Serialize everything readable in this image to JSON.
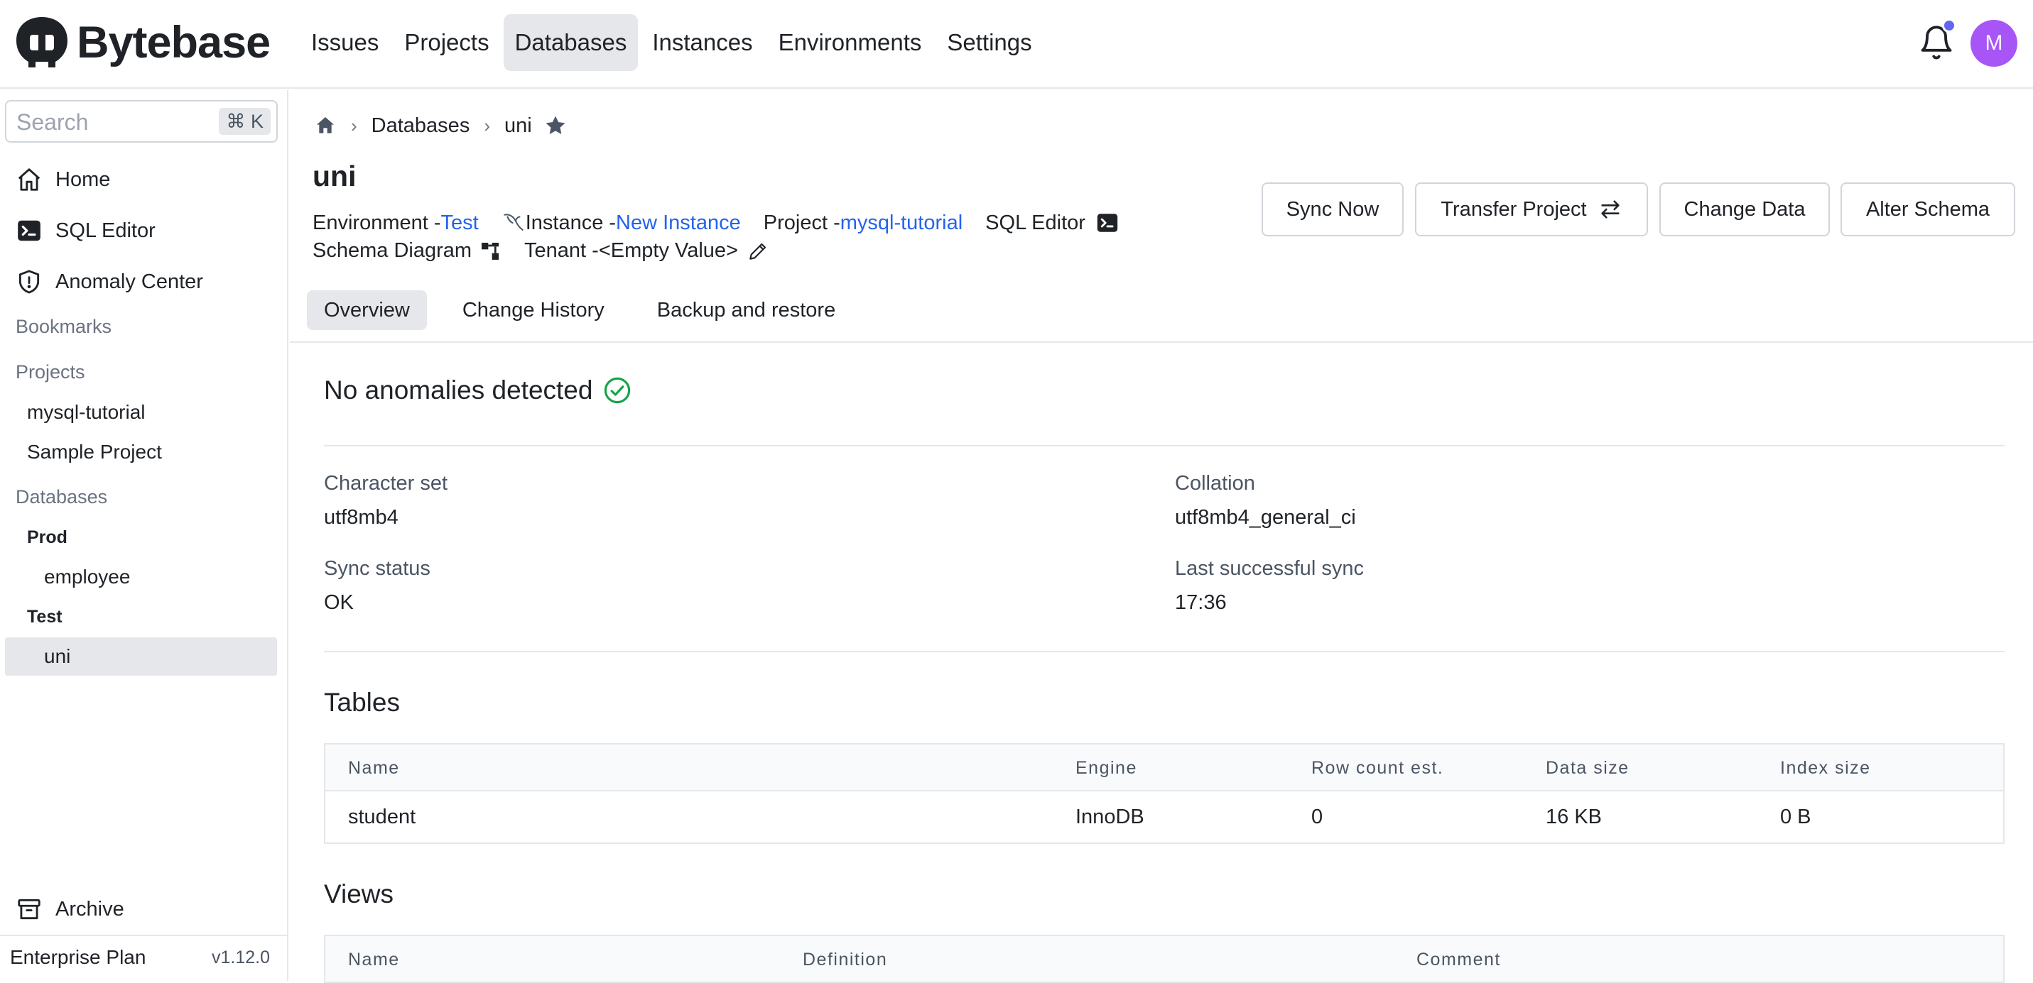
{
  "app": {
    "name": "Bytebase",
    "nav": [
      "Issues",
      "Projects",
      "Databases",
      "Instances",
      "Environments",
      "Settings"
    ],
    "active_nav": "Databases",
    "user_initial": "M",
    "accent_color": "#2563eb",
    "avatar_color": "#a855f7",
    "notification_dot_color": "#6366f1"
  },
  "sidebar": {
    "search_placeholder": "Search",
    "search_shortcut": "⌘ K",
    "links": [
      {
        "label": "Home",
        "icon": "home-icon"
      },
      {
        "label": "SQL Editor",
        "icon": "terminal-icon"
      },
      {
        "label": "Anomaly Center",
        "icon": "shield-icon"
      }
    ],
    "bookmarks_heading": "Bookmarks",
    "projects_heading": "Projects",
    "projects": [
      "mysql-tutorial",
      "Sample Project"
    ],
    "databases_heading": "Databases",
    "environments": [
      {
        "name": "Prod",
        "databases": [
          "employee"
        ]
      },
      {
        "name": "Test",
        "databases": [
          "uni"
        ]
      }
    ],
    "active_database": "uni",
    "archive_label": "Archive",
    "plan": "Enterprise Plan",
    "version": "v1.12.0"
  },
  "breadcrumb": {
    "section": "Databases",
    "current": "uni"
  },
  "database": {
    "name": "uni",
    "environment_label": "Environment - ",
    "environment": "Test",
    "instance_label": "Instance - ",
    "instance": "New Instance",
    "project_label": "Project - ",
    "project": "mysql-tutorial",
    "sql_editor_label": "SQL Editor",
    "schema_diagram_label": "Schema Diagram",
    "tenant_label": "Tenant - ",
    "tenant": "<Empty Value>"
  },
  "actions": {
    "sync_now": "Sync Now",
    "transfer_project": "Transfer Project",
    "change_data": "Change Data",
    "alter_schema": "Alter Schema"
  },
  "tabs": [
    "Overview",
    "Change History",
    "Backup and restore"
  ],
  "active_tab": "Overview",
  "overview": {
    "anomaly_status": "No anomalies detected",
    "properties": {
      "charset_label": "Character set",
      "charset": "utf8mb4",
      "collation_label": "Collation",
      "collation": "utf8mb4_general_ci",
      "sync_status_label": "Sync status",
      "sync_status": "OK",
      "last_sync_label": "Last successful sync",
      "last_sync": "17:36"
    },
    "tables_title": "Tables",
    "tables": {
      "columns": [
        "Name",
        "Engine",
        "Row count est.",
        "Data size",
        "Index size"
      ],
      "rows": [
        [
          "student",
          "InnoDB",
          "0",
          "16 KB",
          "0 B"
        ]
      ]
    },
    "views_title": "Views",
    "views": {
      "columns": [
        "Name",
        "Definition",
        "Comment"
      ]
    }
  }
}
